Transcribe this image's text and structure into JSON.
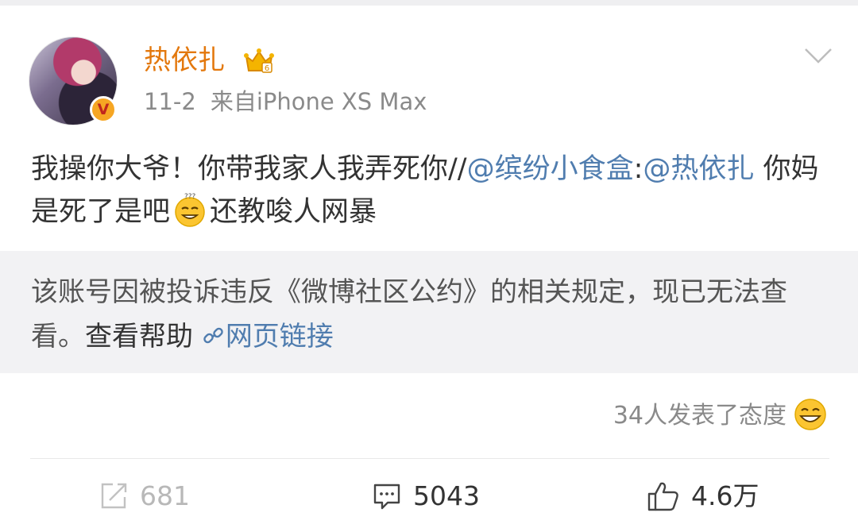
{
  "post": {
    "username": "热依扎",
    "date": "11-2",
    "source": "来自iPhone XS Max",
    "text_part1": "我操你大爷！你带我家人我弄死你//",
    "mention1": "@缤纷小食盒",
    "colon": ":",
    "mention2": "@热依扎",
    "text_part2": " 你妈是死了是吧",
    "text_part3": "还教唆人网暴"
  },
  "notice": {
    "text": "该账号因被投诉违反《微博社区公约》的相关规定，现已无法查看。",
    "help_label": "查看帮助",
    "link_label": "网页链接"
  },
  "reactions": {
    "text": "34人发表了态度"
  },
  "actions": {
    "repost_count": "681",
    "comment_count": "5043",
    "like_count": "4.6万"
  },
  "colors": {
    "username": "#e3780d",
    "link": "#507daf",
    "notice_bg": "#f2f2f4",
    "verified_badge": "#f6a623"
  },
  "icons": [
    "avatar-photo",
    "verified-v-icon",
    "crown-badge-icon",
    "chevron-down-icon",
    "confused-smile-emoji",
    "link-icon",
    "grin-emoji",
    "repost-icon",
    "comment-icon",
    "like-icon"
  ]
}
